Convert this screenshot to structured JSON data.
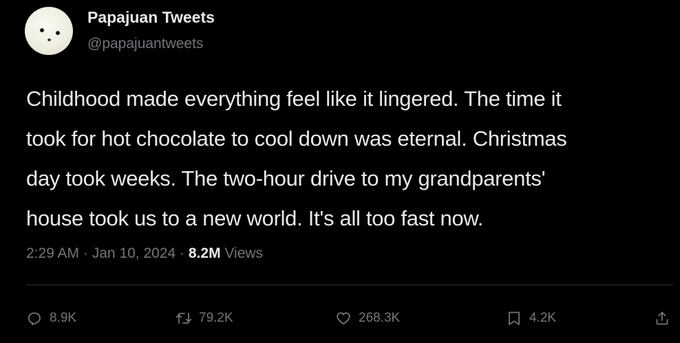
{
  "author": {
    "display_name": "Papajuan Tweets",
    "handle": "@papajuantweets"
  },
  "tweet": {
    "lines": [
      "Childhood made everything feel like it lingered. The time it",
      "took for hot chocolate to cool down was eternal. Christmas",
      "day took weeks. The two-hour drive to my grandparents'",
      "house took us to a new world. It's all too fast now."
    ],
    "time": "2:29 AM",
    "separator": "·",
    "date": "Jan 10, 2024",
    "views_count": "8.2M",
    "views_label": "Views"
  },
  "actions": {
    "replies": "8.9K",
    "retweets": "79.2K",
    "likes": "268.3K",
    "bookmarks": "4.2K"
  },
  "icons": {
    "reply": "reply-icon",
    "retweet": "retweet-icon",
    "like": "heart-icon",
    "bookmark": "bookmark-icon",
    "share": "share-icon"
  },
  "colors": {
    "background": "#000000",
    "text_primary": "#e7e9ea",
    "text_secondary": "#71767b",
    "divider": "#2f3336"
  }
}
